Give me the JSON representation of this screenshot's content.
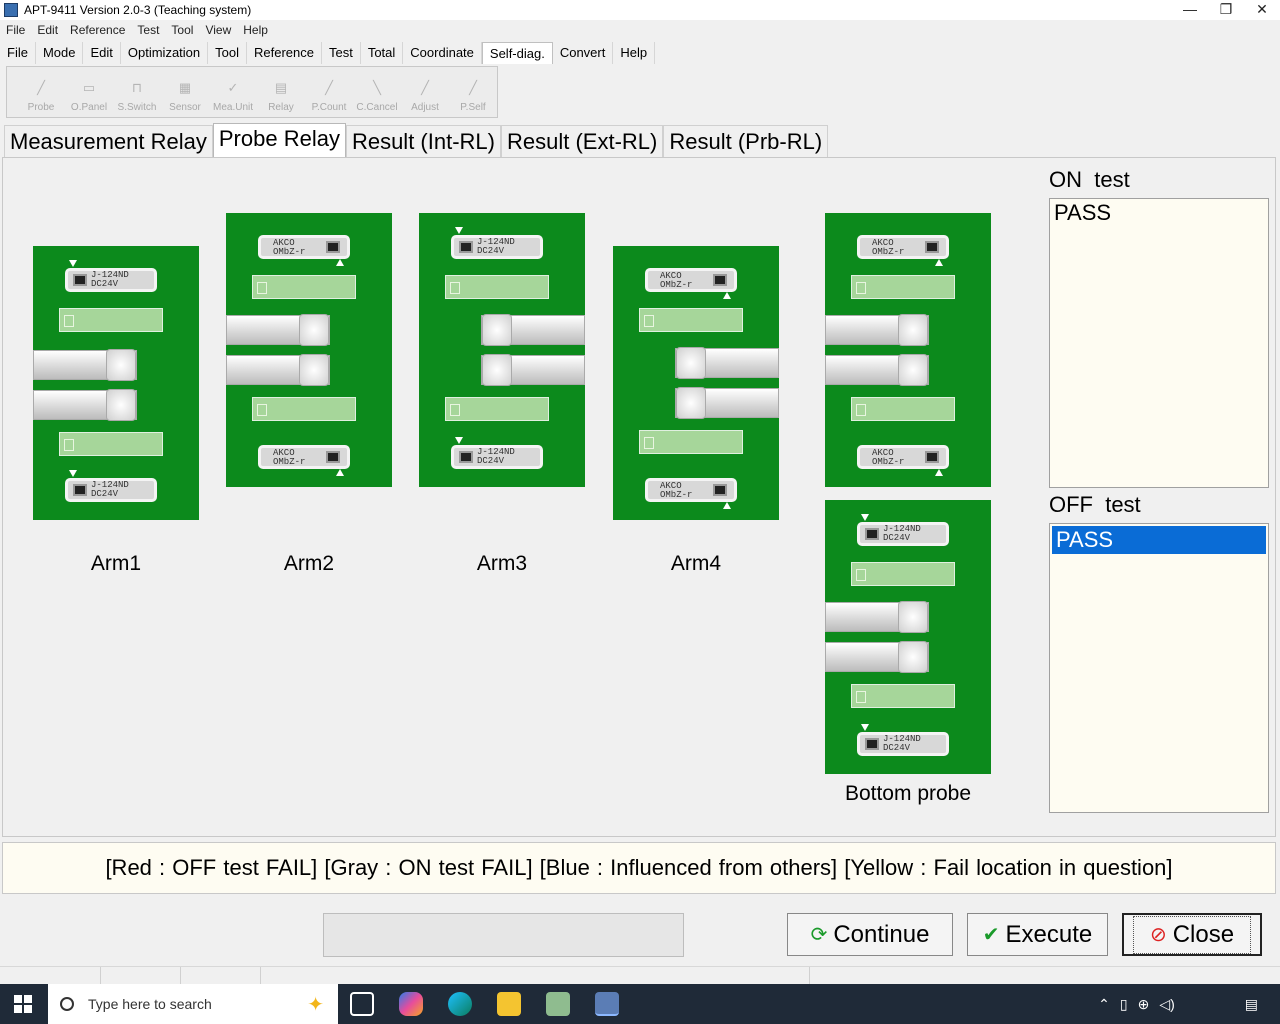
{
  "window": {
    "title": "APT-9411 Version 2.0-3 (Teaching system)",
    "controls": [
      "—",
      "❐",
      "✕"
    ]
  },
  "menubar1": [
    "File",
    "Edit",
    "Reference",
    "Test",
    "Tool",
    "View",
    "Help"
  ],
  "menubar2": [
    "File",
    "Mode",
    "Edit",
    "Optimization",
    "Tool",
    "Reference",
    "Test",
    "Total",
    "Coordinate",
    "Self-diag.",
    "Convert",
    "Help"
  ],
  "menubar2_active": "Self-diag.",
  "toolbar": [
    "Probe",
    "O.Panel",
    "S.Switch",
    "Sensor",
    "Mea.Unit",
    "Relay",
    "P.Count",
    "C.Cancel",
    "Adjust",
    "P.Self"
  ],
  "tabs": [
    "Measurement Relay",
    "Probe Relay",
    "Result (Int-RL)",
    "Result (Ext-RL)",
    "Result (Prb-RL)"
  ],
  "active_tab": "Probe Relay",
  "arms": [
    {
      "label": "Arm1"
    },
    {
      "label": "Arm2"
    },
    {
      "label": "Arm3"
    },
    {
      "label": "Arm4"
    },
    {
      "label": "Bottom probe"
    }
  ],
  "relay_text": {
    "a": "J-124ND\nDC24V",
    "b": "AKCO\nOMbZ-r"
  },
  "on_test": {
    "label": "ON  test",
    "items": [
      "PASS"
    ]
  },
  "off_test": {
    "label": "OFF  test",
    "items": [
      "PASS"
    ]
  },
  "legend": "[Red : OFF test FAIL]   [Gray : ON test FAIL]   [Blue : Influenced from others]   [Yellow : Fail location in question]",
  "buttons": {
    "continue": "Continue",
    "execute": "Execute",
    "close": "Close"
  },
  "taskbar": {
    "search_placeholder": "Type here to search"
  },
  "colors": {
    "board": "#0c8a1c",
    "selection": "#0a6cd6",
    "listbox_bg": "#fefcf2"
  }
}
